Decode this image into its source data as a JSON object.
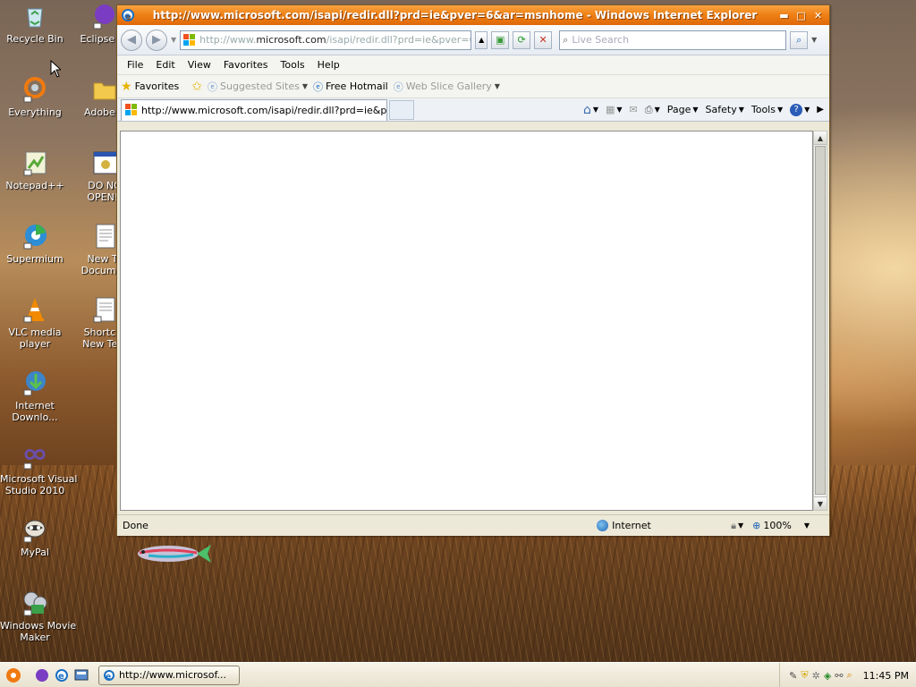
{
  "desktop": {
    "icons": [
      {
        "label": "Recycle Bin"
      },
      {
        "label": "Eclipse Lu"
      },
      {
        "label": "Everything"
      },
      {
        "label": "Adobe C"
      },
      {
        "label": "Notepad++"
      },
      {
        "label": "DO NO\nOPEN!!"
      },
      {
        "label": "Supermium"
      },
      {
        "label": "New Te\nDocumen"
      },
      {
        "label": "VLC media\nplayer"
      },
      {
        "label": "Shortcut\nNew Text"
      },
      {
        "label": "Internet\nDownlo..."
      },
      {
        "label": "Microsoft Visual\nStudio 2010"
      },
      {
        "label": "MyPal"
      },
      {
        "label": "Windows Movie\nMaker"
      }
    ]
  },
  "window": {
    "title": "http://www.microsoft.com/isapi/redir.dll?prd=ie&pver=6&ar=msnhome - Windows Internet Explorer",
    "address": {
      "prefix": "http://www.",
      "host": "microsoft.com",
      "path": "/isapi/redir.dll?prd=ie&pver=6&a"
    },
    "search_placeholder": "Live Search",
    "menu": [
      "File",
      "Edit",
      "View",
      "Favorites",
      "Tools",
      "Help"
    ],
    "favorites_bar": {
      "favorites": "Favorites",
      "suggested": "Suggested Sites",
      "hotmail": "Free Hotmail",
      "webslice": "Web Slice Gallery"
    },
    "tab_title": "http://www.microsoft.com/isapi/redir.dll?prd=ie&pver...",
    "command_bar": {
      "page": "Page",
      "safety": "Safety",
      "tools": "Tools"
    },
    "status": {
      "text": "Done",
      "zone": "Internet",
      "zoom": "100%"
    }
  },
  "taskbar": {
    "task_label": "http://www.microsof...",
    "clock": "11:45 PM"
  },
  "colors": {
    "titlebar": "#ee7f14",
    "taskbar": "#ece9d8"
  }
}
